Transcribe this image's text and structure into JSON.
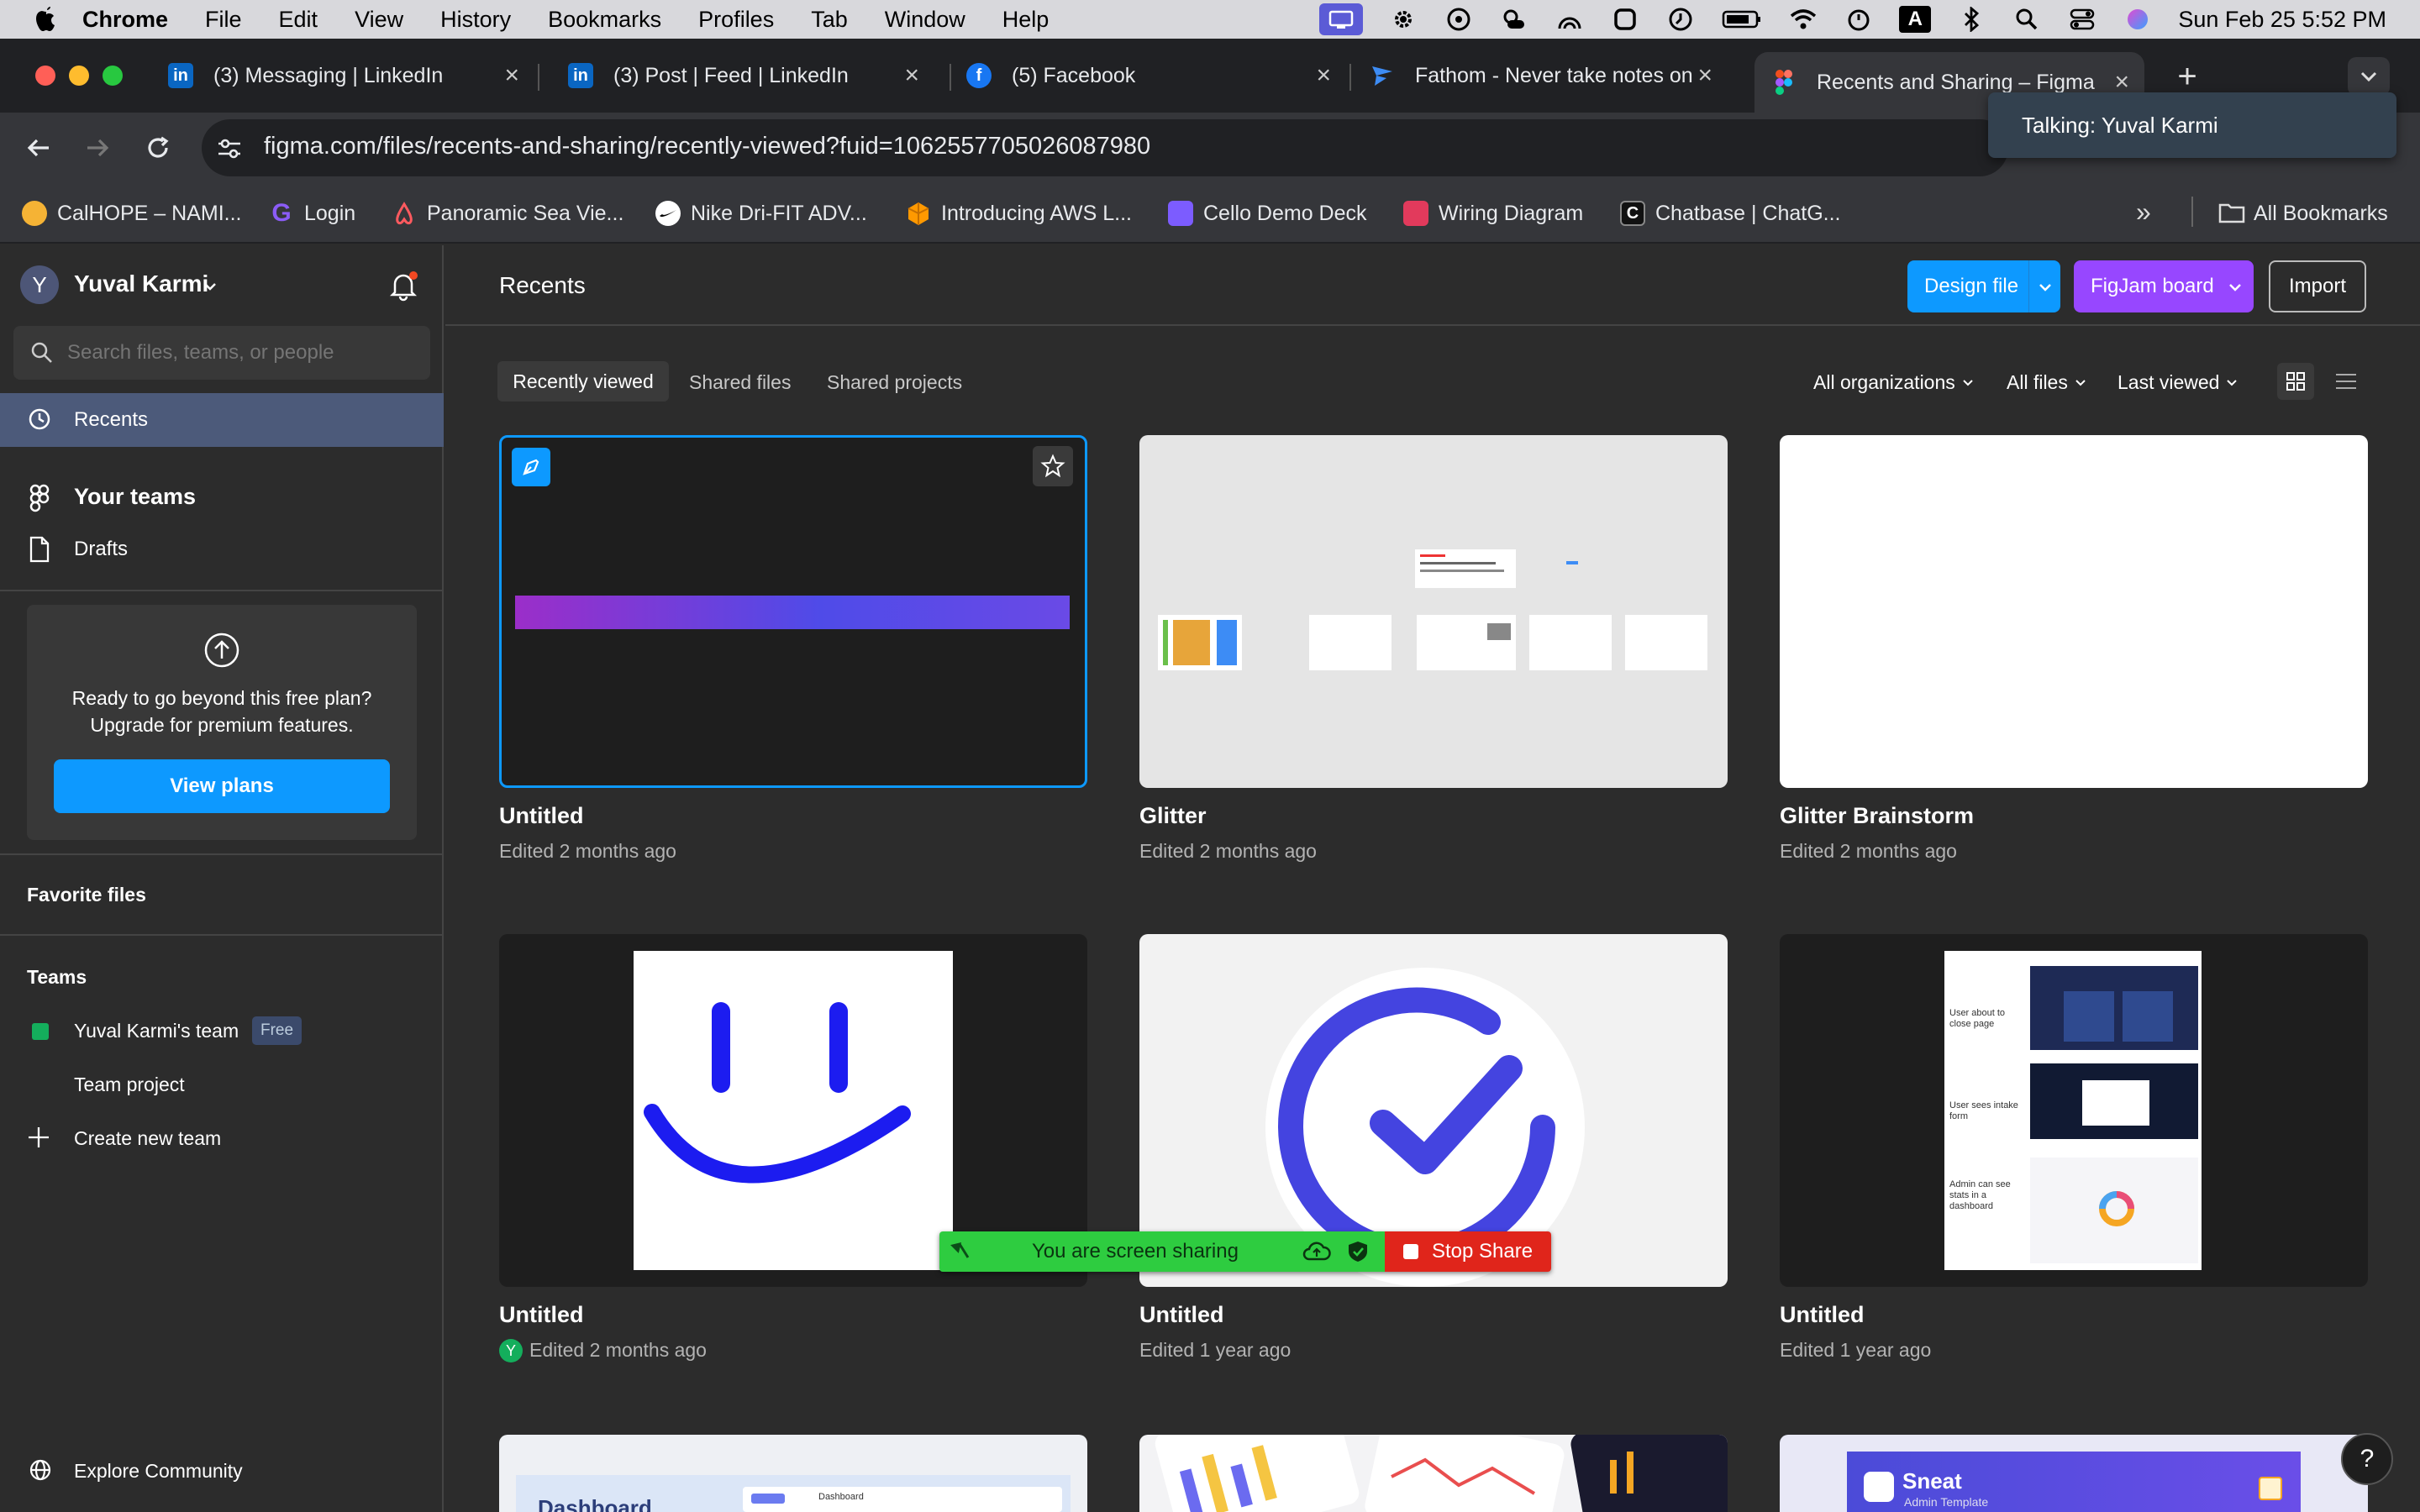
{
  "menubar": {
    "items": [
      "Chrome",
      "File",
      "Edit",
      "View",
      "History",
      "Bookmarks",
      "Profiles",
      "Tab",
      "Window",
      "Help"
    ],
    "clock": "Sun Feb 25  5:52 PM"
  },
  "tabs": [
    {
      "label": "(3) Messaging | LinkedIn",
      "icon": "linkedin-icon"
    },
    {
      "label": "(3) Post | Feed | LinkedIn",
      "icon": "linkedin-icon"
    },
    {
      "label": "(5) Facebook",
      "icon": "facebook-icon"
    },
    {
      "label": "Fathom - Never take notes on",
      "icon": "fathom-icon"
    },
    {
      "label": "Recents and Sharing – Figma",
      "icon": "figma-icon"
    }
  ],
  "address": {
    "url": "figma.com/files/recents-and-sharing/recently-viewed?fuid=1062557705026087980"
  },
  "bookmarks": [
    "CalHOPE – NAMI...",
    "Login",
    "Panoramic Sea Vie...",
    "Nike Dri-FIT ADV...",
    "Introducing AWS L...",
    "Cello Demo Deck",
    "Wiring Diagram",
    "Chatbase | ChatG...",
    "All Bookmarks"
  ],
  "talking": "Talking: Yuval Karmi",
  "sidebar": {
    "user_initial": "Y",
    "user_name": "Yuval Karmi",
    "search_placeholder": "Search files, teams, or people",
    "recents": "Recents",
    "your_teams": "Your teams",
    "drafts": "Drafts",
    "upgrade_line1": "Ready to go beyond this free plan?",
    "upgrade_line2": "Upgrade for premium features.",
    "view_plans": "View plans",
    "favorite_files": "Favorite files",
    "teams": "Teams",
    "team_name": "Yuval Karmi's team",
    "team_badge": "Free",
    "team_project": "Team project",
    "create_team": "Create new team",
    "explore": "Explore Community"
  },
  "main": {
    "title": "Recents",
    "design_file": "Design file",
    "figjam_board": "FigJam board",
    "import": "Import",
    "tabs": [
      "Recently viewed",
      "Shared files",
      "Shared projects"
    ],
    "filters": [
      "All organizations",
      "All files",
      "Last viewed"
    ],
    "files": [
      {
        "title": "Untitled",
        "sub": "Edited 2 months ago"
      },
      {
        "title": "Glitter",
        "sub": "Edited 2 months ago"
      },
      {
        "title": "Glitter Brainstorm",
        "sub": "Edited 2 months ago"
      },
      {
        "title": "Untitled",
        "sub": "Edited 2 months ago"
      },
      {
        "title": "Untitled",
        "sub": "Edited 1 year ago"
      },
      {
        "title": "Untitled",
        "sub": "Edited 1 year ago"
      }
    ],
    "thumb_texts": {
      "flow1": "User about to close page",
      "flow2": "User sees intake form",
      "flow3": "Admin can see stats in a dashboard",
      "dashboard": "Dashboard",
      "sneat": "Sneat",
      "sneat_sub": "Admin Template"
    }
  },
  "share_bar": {
    "label": "You are screen sharing",
    "stop": "Stop Share"
  },
  "help": "?",
  "colors": {
    "accent": "#0d99ff",
    "figjam": "#9747ff",
    "share_green": "#2ecc40",
    "stop_red": "#e0251b"
  }
}
